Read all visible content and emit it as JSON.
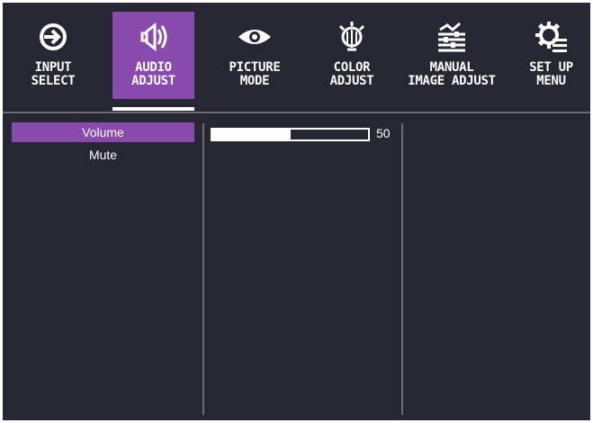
{
  "tabs": [
    {
      "id": "input-select",
      "icon": "input-icon",
      "line1": "INPUT",
      "line2": "SELECT",
      "active": false
    },
    {
      "id": "audio-adjust",
      "icon": "speaker-icon",
      "line1": "AUDIO",
      "line2": "ADJUST",
      "active": true
    },
    {
      "id": "picture-mode",
      "icon": "eye-icon",
      "line1": "PICTURE",
      "line2": "MODE",
      "active": false
    },
    {
      "id": "color-adjust",
      "icon": "bulb-icon",
      "line1": "COLOR",
      "line2": "ADJUST",
      "active": false
    },
    {
      "id": "manual-image-adjust",
      "icon": "image-adjust-icon",
      "line1": "MANUAL",
      "line2": "IMAGE ADJUST",
      "active": false
    },
    {
      "id": "setup-menu",
      "icon": "gear-list-icon",
      "line1": "SET UP",
      "line2": "MENU",
      "active": false
    }
  ],
  "menu": {
    "items": [
      {
        "label": "Volume",
        "selected": true
      },
      {
        "label": "Mute",
        "selected": false
      }
    ]
  },
  "volume": {
    "value": 50,
    "max": 100,
    "display": "50"
  },
  "colors": {
    "background": "#272733",
    "accent": "#8a49ad",
    "divider": "#6c6c76",
    "text": "#ffffff"
  }
}
